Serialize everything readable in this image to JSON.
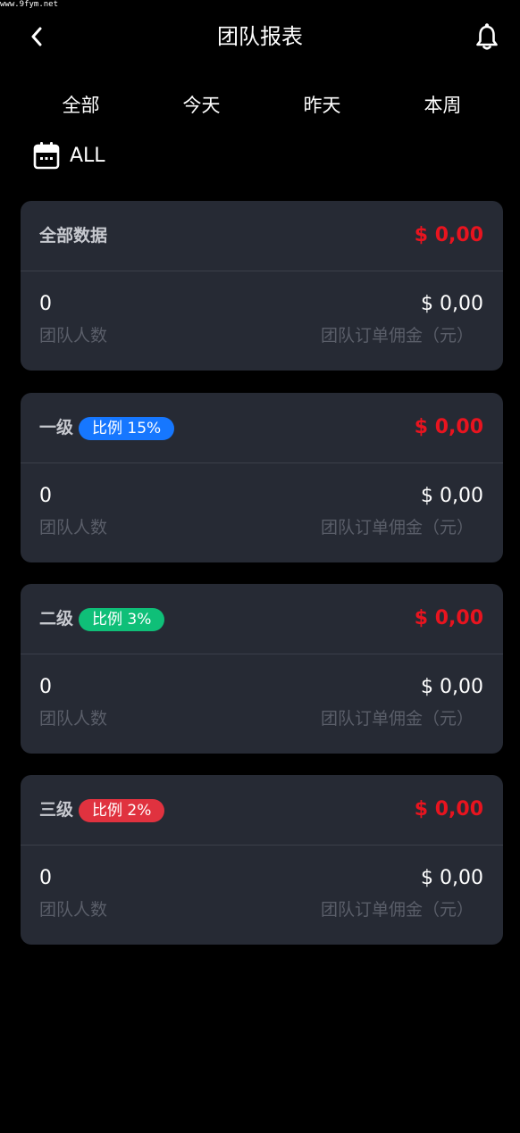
{
  "watermark": "www.9fym.net",
  "header": {
    "title": "团队报表",
    "back_icon": "chevron-left-icon",
    "bell_icon": "bell-icon"
  },
  "tabs": [
    "全部",
    "今天",
    "昨天",
    "本周"
  ],
  "date_filter": {
    "icon": "calendar-icon",
    "label": "ALL"
  },
  "colors": {
    "background": "#000000",
    "card": "#262a34",
    "total_red": "#e8141f",
    "badge_blue": "#1677ff",
    "badge_green": "#0fbf78",
    "badge_red": "#e0323f",
    "muted_label": "#5a5e69"
  },
  "cards": [
    {
      "name": "全部数据",
      "badge": "",
      "total": "$ 0,00",
      "members_value": "0",
      "members_label": "团队人数",
      "commission_value": "$ 0,00",
      "commission_label": "团队订单佣金（元）"
    },
    {
      "name": "一级",
      "badge": "比例 15%",
      "total": "$ 0,00",
      "members_value": "0",
      "members_label": "团队人数",
      "commission_value": "$ 0,00",
      "commission_label": "团队订单佣金（元）"
    },
    {
      "name": "二级",
      "badge": "比例 3%",
      "total": "$ 0,00",
      "members_value": "0",
      "members_label": "团队人数",
      "commission_value": "$ 0,00",
      "commission_label": "团队订单佣金（元）"
    },
    {
      "name": "三级",
      "badge": "比例 2%",
      "total": "$ 0,00",
      "members_value": "0",
      "members_label": "团队人数",
      "commission_value": "$ 0,00",
      "commission_label": "团队订单佣金（元）"
    }
  ]
}
